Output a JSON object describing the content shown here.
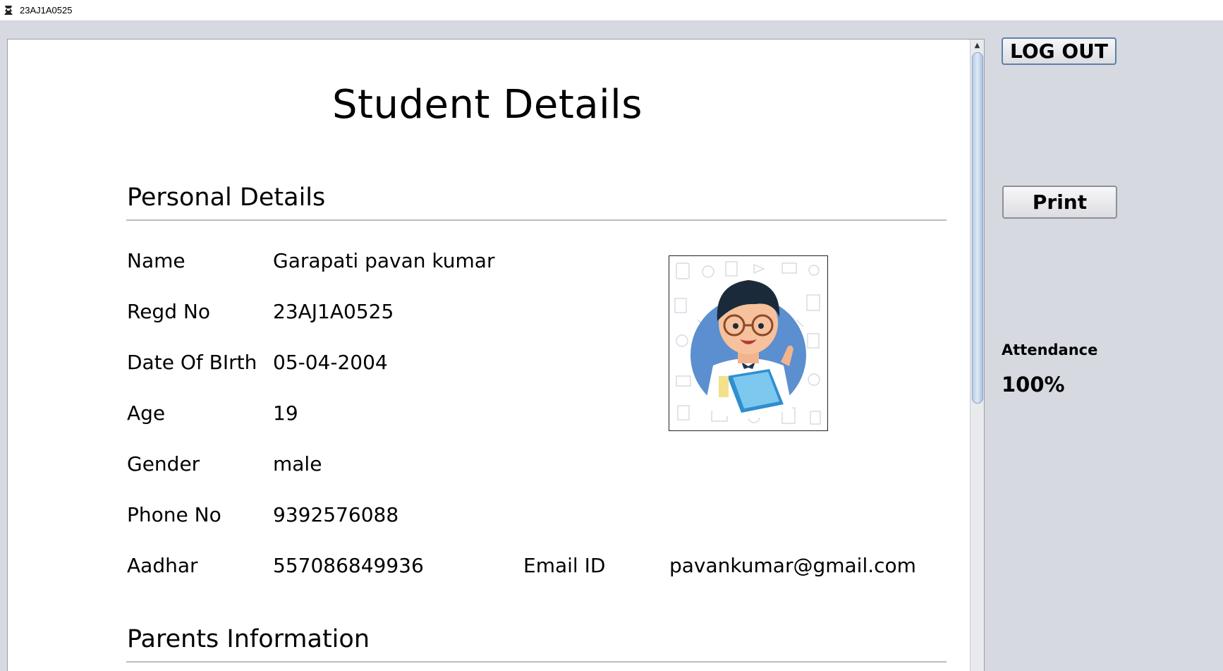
{
  "window": {
    "title": "23AJ1A0525"
  },
  "page": {
    "title": "Student Details"
  },
  "personal": {
    "section_title": "Personal Details",
    "name_label": "Name",
    "name_value": "Garapati pavan kumar",
    "regd_label": "Regd No",
    "regd_value": "23AJ1A0525",
    "dob_label": "Date Of BIrth",
    "dob_value": "05-04-2004",
    "age_label": "Age",
    "age_value": "19",
    "gender_label": "Gender",
    "gender_value": "male",
    "phone_label": "Phone No",
    "phone_value": "9392576088",
    "aadhar_label": "Aadhar",
    "aadhar_value": "557086849936",
    "email_label": "Email ID",
    "email_value": "pavankumar@gmail.com"
  },
  "parents": {
    "section_title": "Parents Information"
  },
  "sidebar": {
    "logout_label": "LOG OUT",
    "print_label": "Print",
    "attendance_label": "Attendance",
    "attendance_value": "100%"
  },
  "icons": {
    "app": "app-icon",
    "photo": "student-avatar",
    "scroll_up": "arrow-up-icon"
  },
  "colors": {
    "background": "#d6d9e0",
    "panel": "#ffffff",
    "photo_circle": "#5b8fcf"
  }
}
